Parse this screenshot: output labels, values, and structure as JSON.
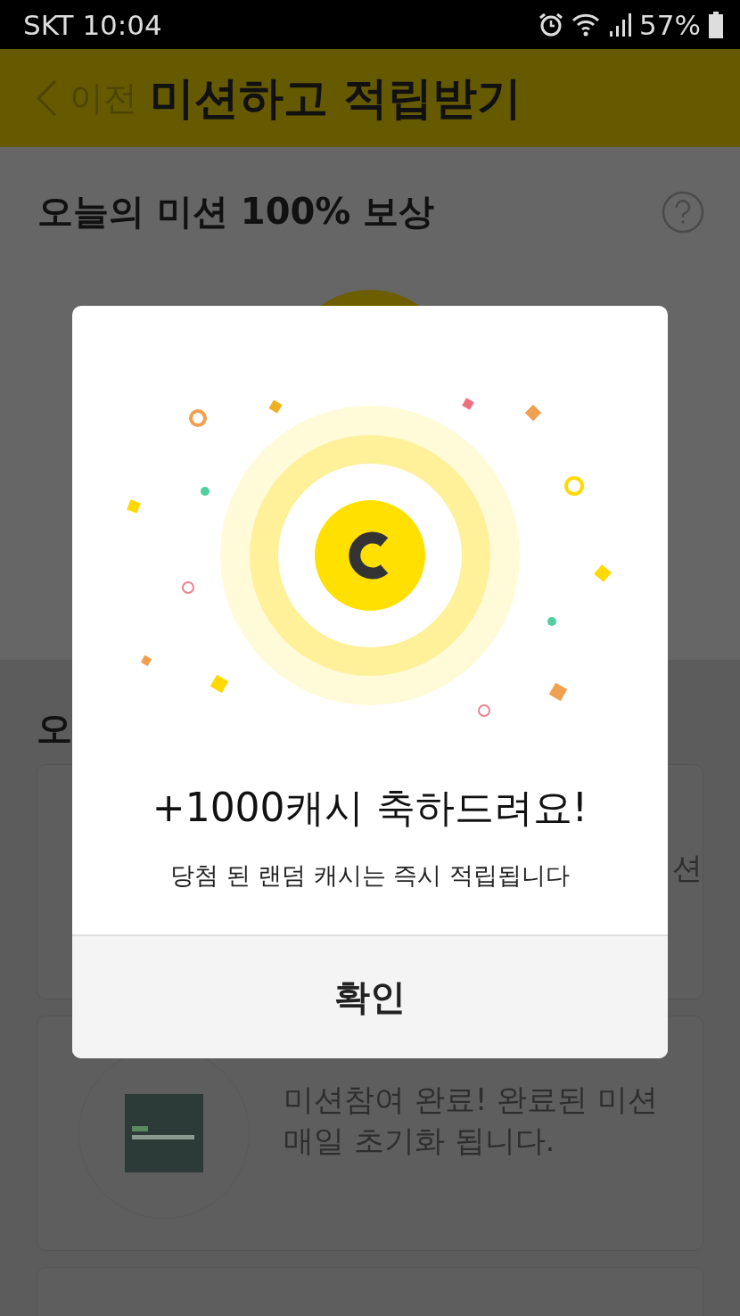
{
  "status_bar": {
    "carrier_time": "SKT 10:04",
    "battery": "57%"
  },
  "header": {
    "back_label": "이전",
    "title": "미션하고 적립받기"
  },
  "mission": {
    "title": "오늘의 미션 100% 보상"
  },
  "list": {
    "title": "오",
    "cards": [
      {
        "kind": "text",
        "lines": [
          "션"
        ]
      },
      {
        "kind": "logo",
        "lines": [
          "미션참여 완료!  완료된 미션",
          "매일 초기화 됩니다."
        ]
      },
      {
        "kind": "empty"
      }
    ]
  },
  "dialog": {
    "title": "+1000캐시 축하드려요!",
    "message": "당첨 된 랜덤 캐시는 즉시 적립됩니다",
    "button": "확인"
  }
}
